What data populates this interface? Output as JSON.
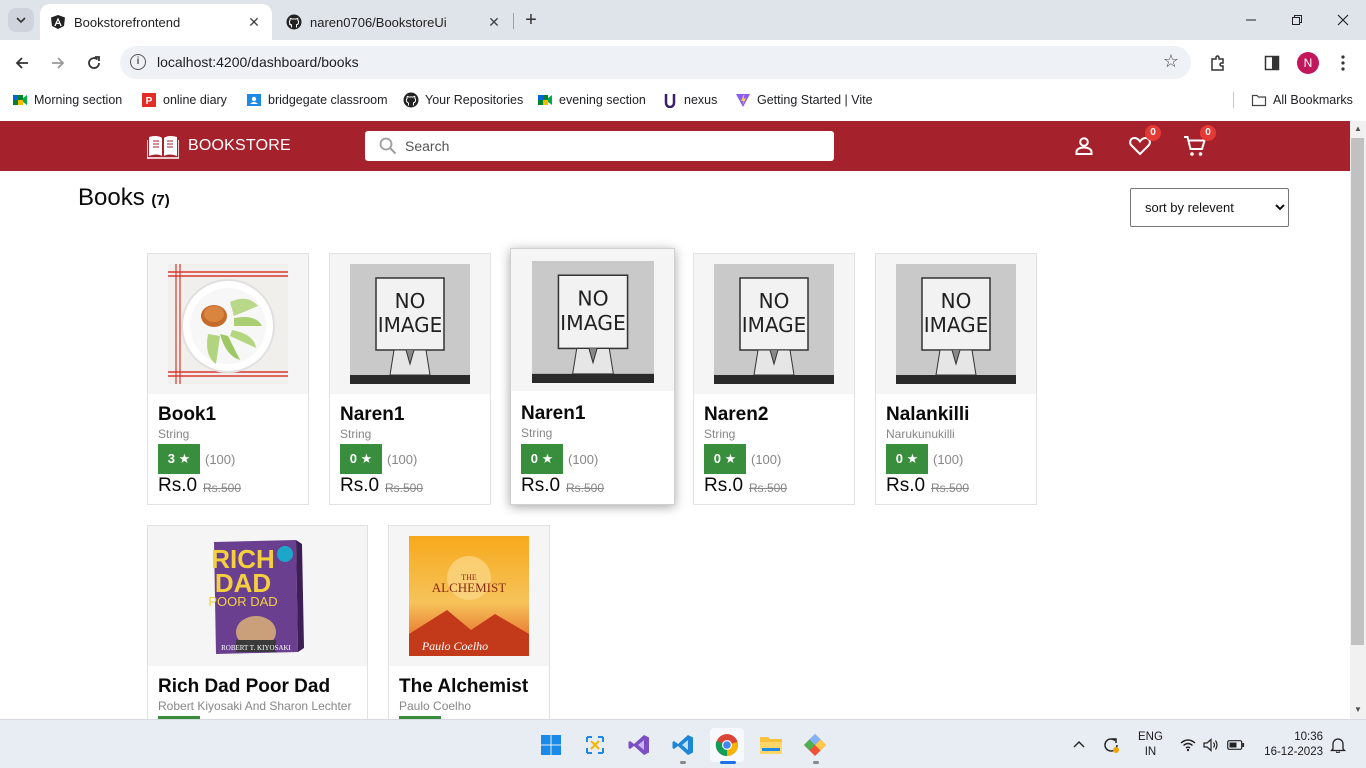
{
  "browser": {
    "tabs": [
      {
        "title": "Bookstorefrontend",
        "active": true,
        "icon": "angular-icon"
      },
      {
        "title": "naren0706/BookstoreUi",
        "active": false,
        "icon": "github-icon"
      }
    ],
    "url": "localhost:4200/dashboard/books",
    "profile_initial": "N",
    "bookmarks": [
      {
        "label": "Morning section",
        "icon": "google-meet-icon"
      },
      {
        "label": "online diary",
        "icon": "diary-icon"
      },
      {
        "label": "bridgegate classroom",
        "icon": "classroom-icon"
      },
      {
        "label": "Your Repositories",
        "icon": "github-icon"
      },
      {
        "label": "evening section",
        "icon": "google-meet-icon"
      },
      {
        "label": "nexus",
        "icon": "nexus-icon"
      },
      {
        "label": "Getting Started | Vite",
        "icon": "vite-icon"
      }
    ],
    "all_bookmarks": "All Bookmarks"
  },
  "app": {
    "brand": "BOOKSTORE",
    "brand_color": "#a5222d",
    "search_placeholder": "Search",
    "wishlist_count": "0",
    "cart_count": "0"
  },
  "page": {
    "title": "Books",
    "count": "(7)",
    "sort_selected": "sort by relevent"
  },
  "books": [
    {
      "name": "Book1",
      "author": "String",
      "rating": "3 ★",
      "rating_count": "(100)",
      "price": "Rs.0",
      "mrp": "Rs.500",
      "cover": "apple-slices"
    },
    {
      "name": "Naren1",
      "author": "String",
      "rating": "0 ★",
      "rating_count": "(100)",
      "price": "Rs.0",
      "mrp": "Rs.500",
      "cover": "no-image"
    },
    {
      "name": "Naren1",
      "author": "String",
      "rating": "0 ★",
      "rating_count": "(100)",
      "price": "Rs.0",
      "mrp": "Rs.500",
      "cover": "no-image"
    },
    {
      "name": "Naren2",
      "author": "String",
      "rating": "0 ★",
      "rating_count": "(100)",
      "price": "Rs.0",
      "mrp": "Rs.500",
      "cover": "no-image"
    },
    {
      "name": "Nalankilli",
      "author": "Narukunukilli",
      "rating": "0 ★",
      "rating_count": "(100)",
      "price": "Rs.0",
      "mrp": "Rs.500",
      "cover": "no-image"
    },
    {
      "name": "Rich Dad Poor Dad",
      "author": "Robert Kiyosaki And Sharon Lechter",
      "cover": "rich-dad-poor-dad",
      "cover_text": [
        "RICH",
        "DAD",
        "POOR DAD",
        "ROBERT T. KIYOSAKI"
      ]
    },
    {
      "name": "The Alchemist",
      "author": "Paulo Coelho",
      "cover": "the-alchemist",
      "cover_text": [
        "THE",
        "ALCHEMIST",
        "Paulo Coelho"
      ]
    }
  ],
  "no_image_text": [
    "NO",
    "IMAGE"
  ],
  "taskbar": {
    "language": "ENG",
    "region": "IN",
    "time": "10:36",
    "date": "16-12-2023",
    "apps": [
      "start-icon",
      "snipping-tool-icon",
      "visual-studio-icon",
      "vscode-icon",
      "chrome-icon",
      "file-explorer-icon",
      "git-icon"
    ]
  }
}
